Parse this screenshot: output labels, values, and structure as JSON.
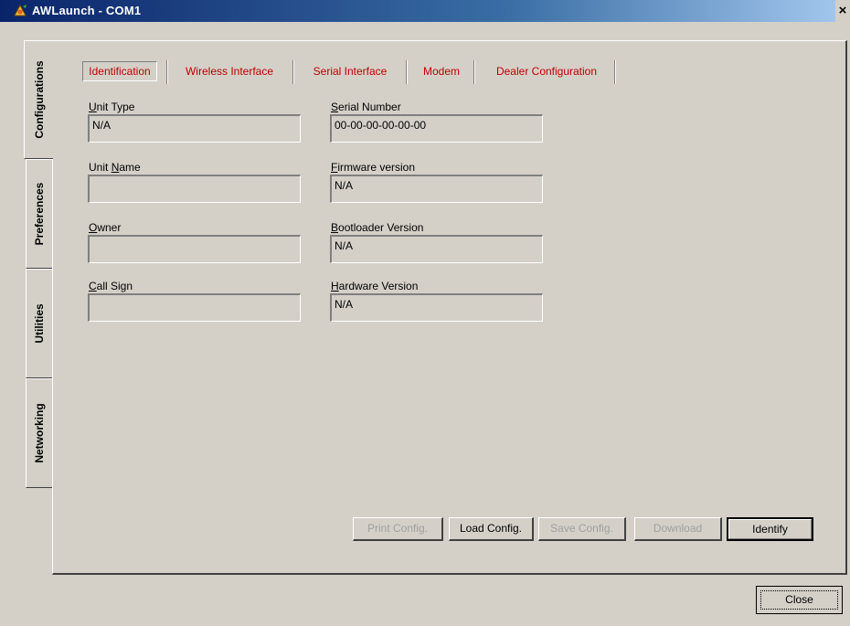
{
  "window": {
    "title": "AWLaunch - COM1",
    "close_glyph": "×"
  },
  "side_tabs": [
    {
      "label": "Configurations",
      "active": true
    },
    {
      "label": "Preferences",
      "active": false
    },
    {
      "label": "Utilities",
      "active": false
    },
    {
      "label": "Networking",
      "active": false
    }
  ],
  "top_tabs": [
    {
      "label": "Identification",
      "selected": true
    },
    {
      "label": "Wireless Interface",
      "selected": false
    },
    {
      "label": "Serial Interface",
      "selected": false
    },
    {
      "label": "Modem",
      "selected": false
    },
    {
      "label": "Dealer Configuration",
      "selected": false
    }
  ],
  "fields": {
    "unit_type": {
      "label_u": "U",
      "label_rest": "nit Type",
      "value": "N/A"
    },
    "unit_name": {
      "label_pre": "Unit ",
      "label_u": "N",
      "label_rest": "ame",
      "value": ""
    },
    "owner": {
      "label_u": "O",
      "label_rest": "wner",
      "value": ""
    },
    "call_sign": {
      "label_u": "C",
      "label_rest": "all Sign",
      "value": ""
    },
    "serial_number": {
      "label_u": "S",
      "label_rest": "erial Number",
      "value": "00-00-00-00-00-00"
    },
    "firmware_version": {
      "label_u": "F",
      "label_rest": "irmware version",
      "value": "N/A"
    },
    "bootloader_version": {
      "label_u": "B",
      "label_rest": "ootloader Version",
      "value": "N/A"
    },
    "hardware_version": {
      "label_u": "H",
      "label_rest": "ardware Version",
      "value": "N/A"
    }
  },
  "buttons": {
    "print_config": "Print Config.",
    "load_config": "Load Config.",
    "save_config": "Save Config.",
    "download": "Download",
    "identify": "Identify",
    "close": "Close"
  },
  "colors": {
    "face": "#d4d0c8",
    "tab_text": "#c00000",
    "titlebar_start": "#0a246a",
    "titlebar_end": "#a6caf0"
  },
  "icons": {
    "app": "awlaunch-app-icon",
    "close": "close-icon"
  }
}
